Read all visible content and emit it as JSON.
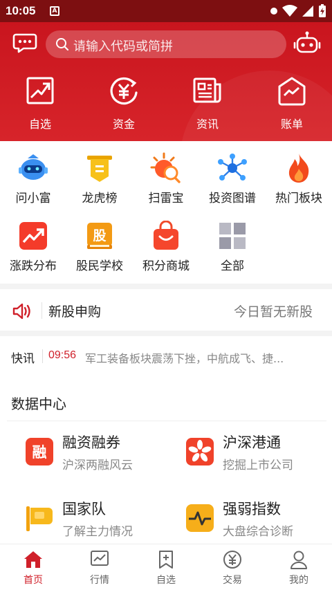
{
  "status_bar": {
    "time": "10:05",
    "badge": "A"
  },
  "header": {
    "search_placeholder": "请输入代码或简拼",
    "quick": [
      {
        "label": "自选",
        "icon": "trend-chart-icon"
      },
      {
        "label": "资金",
        "icon": "yuan-cycle-icon"
      },
      {
        "label": "资讯",
        "icon": "newspaper-icon"
      },
      {
        "label": "账单",
        "icon": "bill-house-icon"
      }
    ]
  },
  "features": [
    {
      "label": "问小富",
      "icon": "robot-assistant-icon"
    },
    {
      "label": "龙虎榜",
      "icon": "banner-ribbon-icon"
    },
    {
      "label": "扫雷宝",
      "icon": "mine-scan-icon"
    },
    {
      "label": "投资图谱",
      "icon": "network-graph-icon"
    },
    {
      "label": "热门板块",
      "icon": "flame-icon"
    },
    {
      "label": "涨跌分布",
      "icon": "rise-fall-icon"
    },
    {
      "label": "股民学校",
      "icon": "school-book-icon",
      "glyph": "股"
    },
    {
      "label": "积分商城",
      "icon": "shopping-bag-icon"
    },
    {
      "label": "全部",
      "icon": "all-grid-icon"
    }
  ],
  "ipo": {
    "title": "新股申购",
    "status": "今日暂无新股"
  },
  "flash": {
    "label": "快讯",
    "time": "09:56",
    "text": "军工装备板块震荡下挫，中航成飞、捷..."
  },
  "data_center": {
    "title": "数据中心",
    "items": [
      {
        "title": "融资融券",
        "subtitle": "沪深两融风云",
        "icon": "margin-trading-icon",
        "glyph": "融"
      },
      {
        "title": "沪深港通",
        "subtitle": "挖掘上市公司",
        "icon": "bauhinia-flower-icon"
      },
      {
        "title": "国家队",
        "subtitle": "了解主力情况",
        "icon": "flag-icon"
      },
      {
        "title": "强弱指数",
        "subtitle": "大盘综合诊断",
        "icon": "pulse-index-icon"
      }
    ]
  },
  "bottom_nav": [
    {
      "label": "首页",
      "icon": "home-icon",
      "active": true
    },
    {
      "label": "行情",
      "icon": "market-chart-icon"
    },
    {
      "label": "自选",
      "icon": "bookmark-plus-icon"
    },
    {
      "label": "交易",
      "icon": "yuan-coin-icon"
    },
    {
      "label": "我的",
      "icon": "user-icon"
    }
  ],
  "colors": {
    "brand_red": "#d0202a",
    "header_red": "#c9151e",
    "status_bar": "#7d0f11"
  }
}
